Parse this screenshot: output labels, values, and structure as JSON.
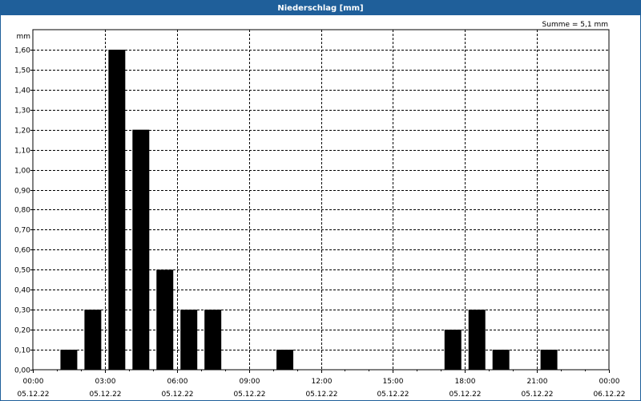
{
  "window": {
    "title": "Niederschlag [mm]"
  },
  "summary": "Summe = 5,1 mm",
  "colors": {
    "titlebar": "#1f5f9a",
    "bar": "#000000",
    "grid": "#000000"
  },
  "chart_data": {
    "type": "bar",
    "ylabel": "mm",
    "ylim": [
      0,
      1.7
    ],
    "y_ticks": [
      "0,00",
      "0,10",
      "0,20",
      "0,30",
      "0,40",
      "0,50",
      "0,60",
      "0,70",
      "0,80",
      "0,90",
      "1,00",
      "1,10",
      "1,20",
      "1,30",
      "1,40",
      "1,50",
      "1,60"
    ],
    "x_range_hours": [
      0,
      24
    ],
    "x_ticks": [
      {
        "time": "00:00",
        "date": "05.12.22"
      },
      {
        "time": "03:00",
        "date": "05.12.22"
      },
      {
        "time": "06:00",
        "date": "05.12.22"
      },
      {
        "time": "09:00",
        "date": "05.12.22"
      },
      {
        "time": "12:00",
        "date": "05.12.22"
      },
      {
        "time": "15:00",
        "date": "05.12.22"
      },
      {
        "time": "18:00",
        "date": "05.12.22"
      },
      {
        "time": "21:00",
        "date": "05.12.22"
      },
      {
        "time": "00:00",
        "date": "06.12.22"
      }
    ],
    "grid": true,
    "bars": [
      {
        "time": "01:00-02:00",
        "value": 0.1
      },
      {
        "time": "02:00-03:00",
        "value": 0.3
      },
      {
        "time": "03:00-04:00",
        "value": 1.6
      },
      {
        "time": "04:00-05:00",
        "value": 1.2
      },
      {
        "time": "05:00-06:00",
        "value": 0.5
      },
      {
        "time": "06:00-07:00",
        "value": 0.3
      },
      {
        "time": "07:00-08:00",
        "value": 0.3
      },
      {
        "time": "10:00-11:00",
        "value": 0.1
      },
      {
        "time": "17:00-18:00",
        "value": 0.2
      },
      {
        "time": "18:00-19:00",
        "value": 0.3
      },
      {
        "time": "19:00-20:00",
        "value": 0.1
      },
      {
        "time": "21:00-22:00",
        "value": 0.1
      }
    ]
  }
}
